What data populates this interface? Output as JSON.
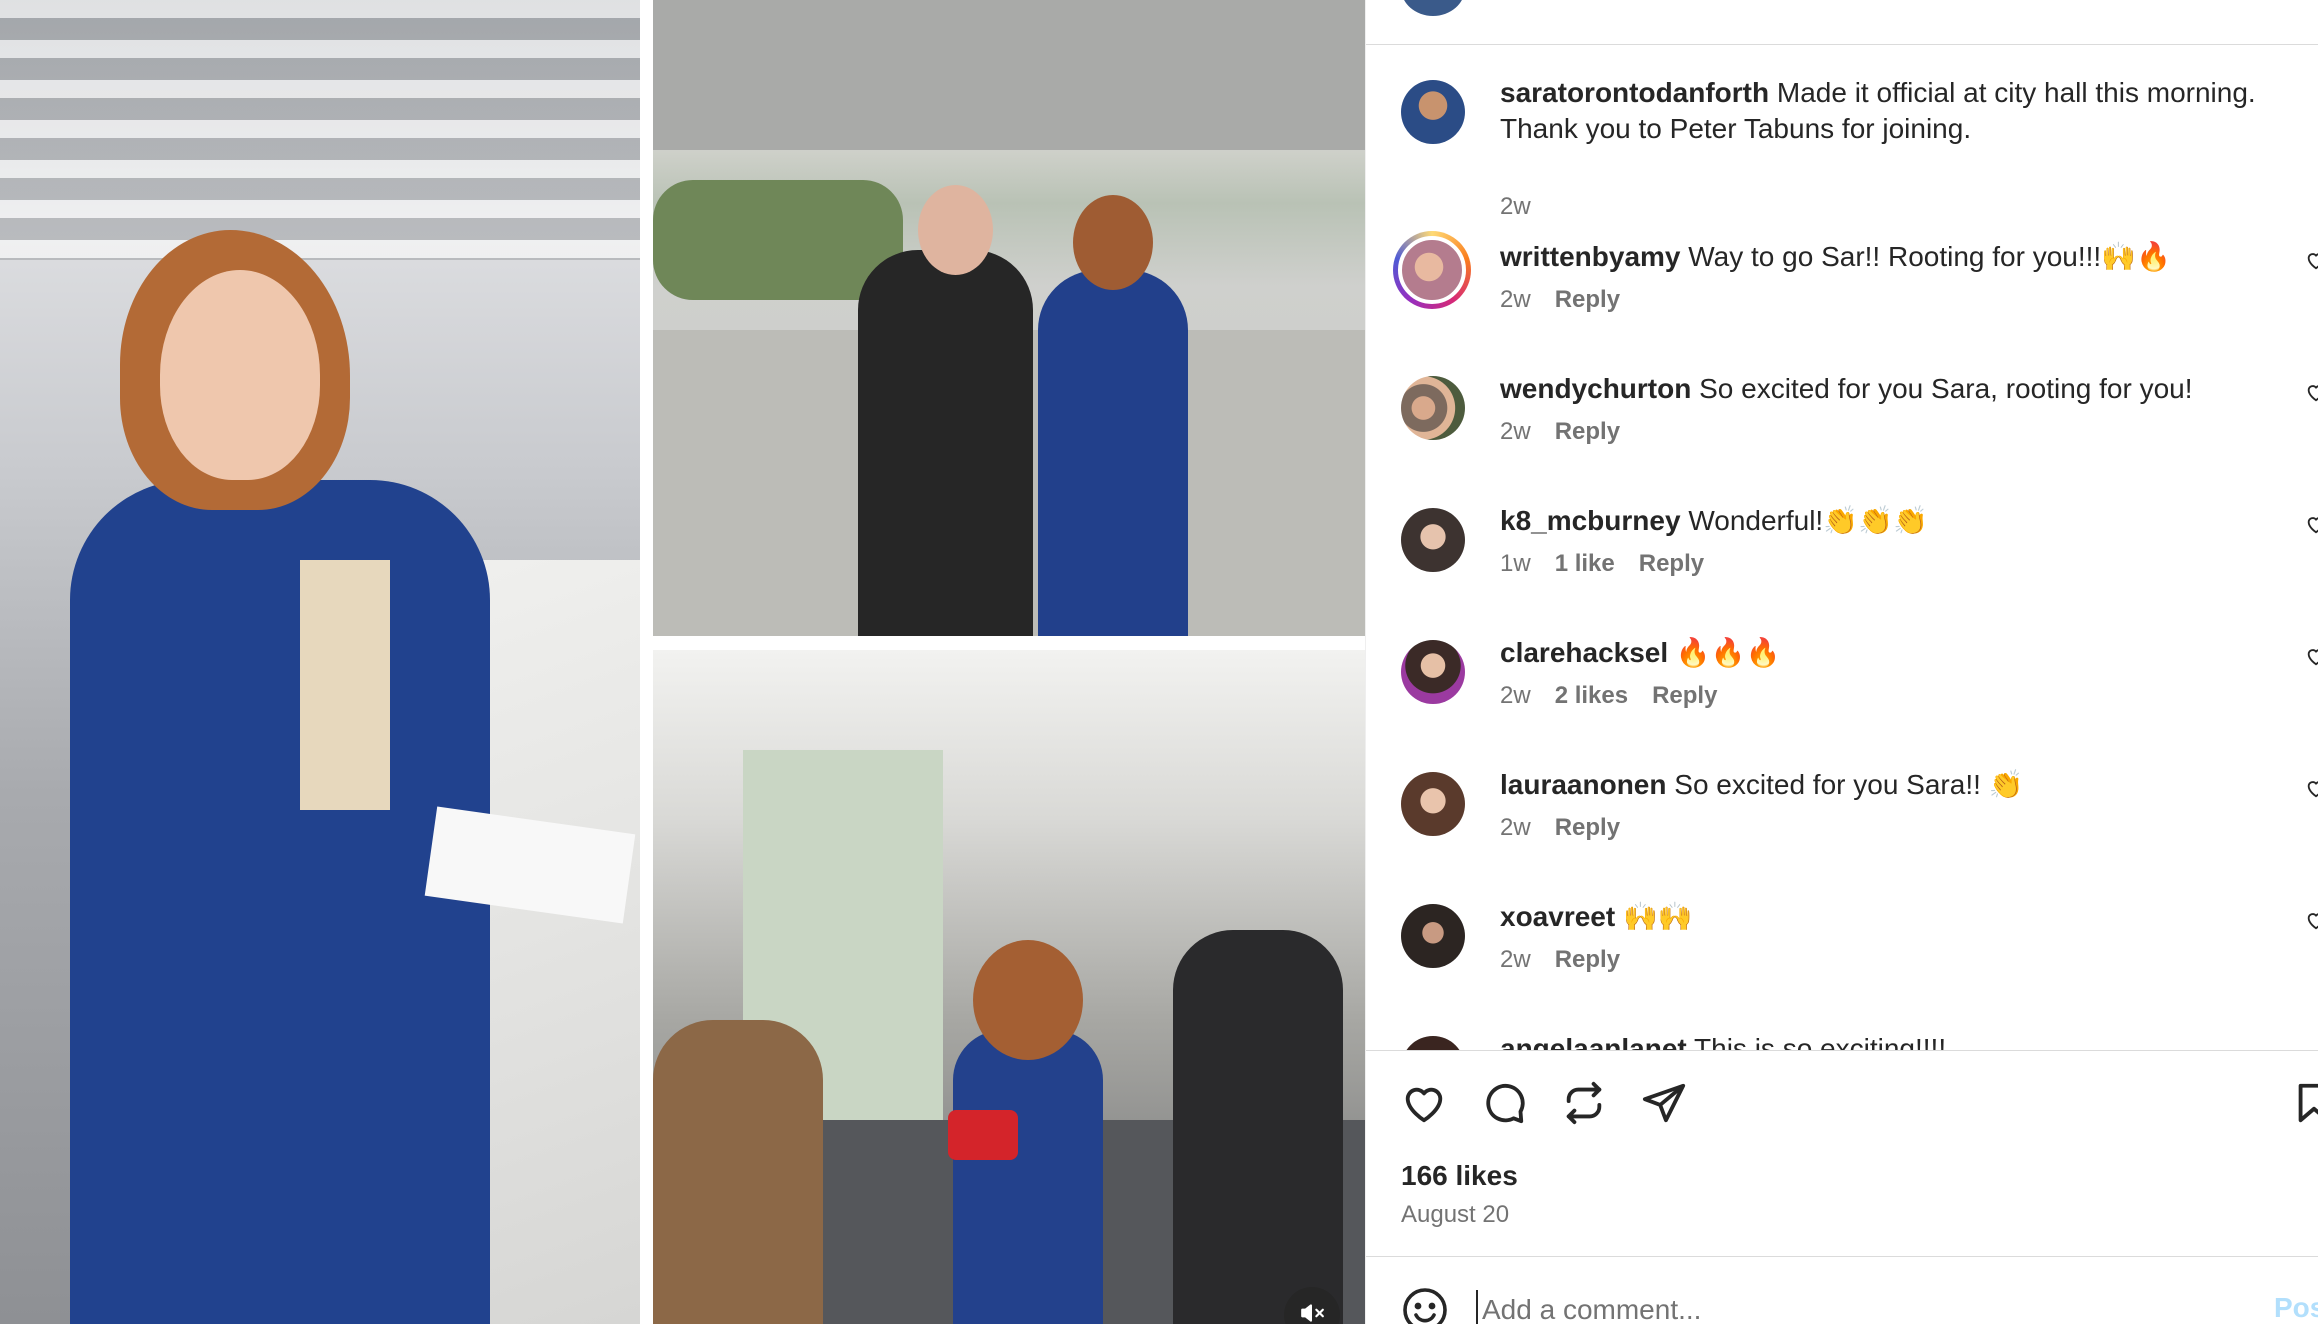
{
  "post": {
    "caption": {
      "username": "saratorontodanforth",
      "text": "Made it official at city hall this morning. Thank you to Peter Tabuns for joining.",
      "time": "2w"
    },
    "comments": [
      {
        "username": "writtenbyamy",
        "text": "Way to go Sar!! Rooting for you!!!🙌🔥",
        "time": "2w",
        "likes": "",
        "reply": "Reply"
      },
      {
        "username": "wendychurton",
        "text": "So excited for you Sara, rooting for you!",
        "time": "2w",
        "likes": "",
        "reply": "Reply"
      },
      {
        "username": "k8_mcburney",
        "text": "Wonderful!👏👏👏",
        "time": "1w",
        "likes": "1 like",
        "reply": "Reply"
      },
      {
        "username": "clarehacksel",
        "text": "🔥🔥🔥",
        "time": "2w",
        "likes": "2 likes",
        "reply": "Reply"
      },
      {
        "username": "lauraanonen",
        "text": "So excited for you Sara!! 👏",
        "time": "2w",
        "likes": "",
        "reply": "Reply"
      },
      {
        "username": "xoavreet",
        "text": "🙌🙌",
        "time": "2w",
        "likes": "",
        "reply": "Reply"
      },
      {
        "username": "angelaanlanet",
        "text": "This is so exciting!!!!",
        "time": "",
        "likes": "",
        "reply": ""
      }
    ],
    "likes_count": "166 likes",
    "date": "August 20",
    "compose": {
      "placeholder": "Add a comment...",
      "post_label": "Post"
    }
  },
  "icons": {
    "like": "heart-icon",
    "comment": "comment-icon",
    "repost": "repost-icon",
    "share": "send-icon",
    "save": "bookmark-icon",
    "emoji": "emoji-icon",
    "mute": "mute-icon"
  },
  "colors": {
    "text": "#262626",
    "secondary": "#737373",
    "divider": "#dbdbdb",
    "post_disabled": "#b2dffc"
  }
}
